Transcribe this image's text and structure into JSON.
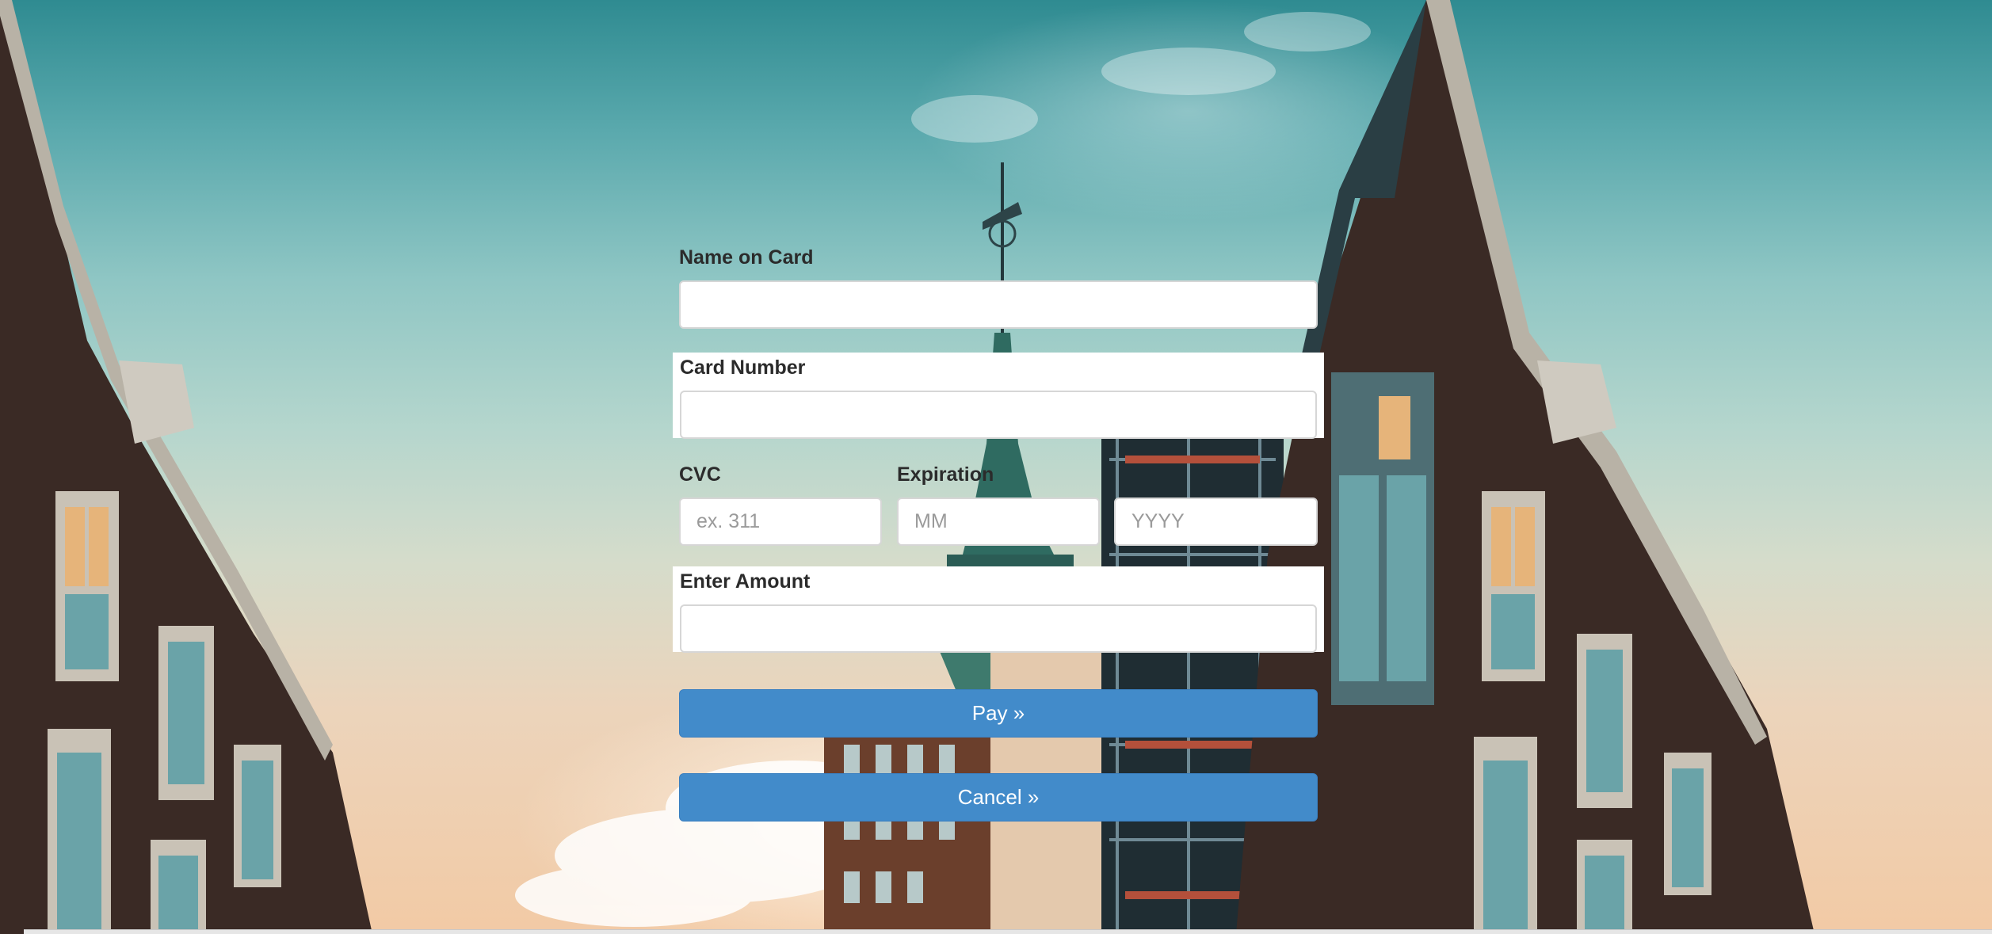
{
  "form": {
    "name_on_card": {
      "label": "Name on Card",
      "value": "",
      "placeholder": ""
    },
    "card_number": {
      "label": "Card Number",
      "value": "",
      "placeholder": ""
    },
    "cvc": {
      "label": "CVC",
      "value": "",
      "placeholder": "ex. 311"
    },
    "expiration": {
      "label": "Expiration",
      "month": {
        "value": "",
        "placeholder": "MM"
      },
      "year": {
        "value": "",
        "placeholder": "YYYY"
      }
    },
    "amount": {
      "label": "Enter Amount",
      "value": "",
      "placeholder": ""
    },
    "pay_label": "Pay »",
    "cancel_label": "Cancel »"
  },
  "colors": {
    "button": "#428bca",
    "label_text": "#2b2b2b",
    "input_bg": "#ffffff"
  }
}
